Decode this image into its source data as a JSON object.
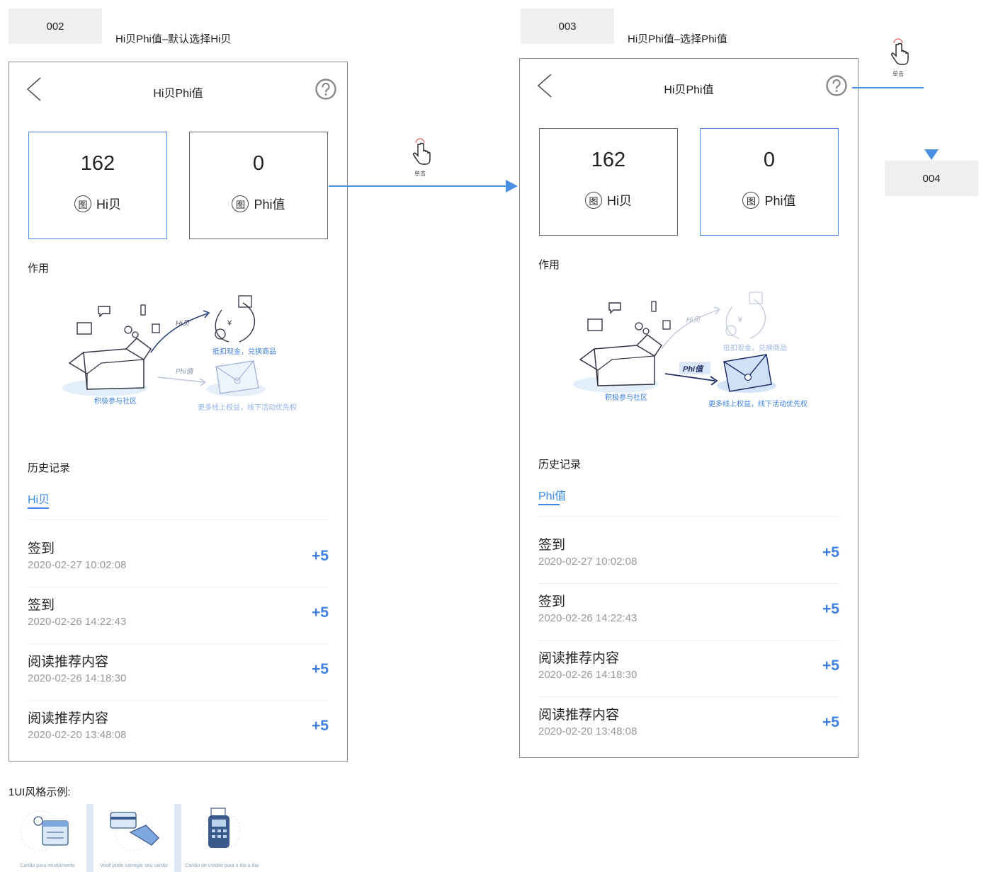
{
  "screens": [
    {
      "id_tag": "002",
      "note": "Hi贝Phi值–默认选择Hi贝",
      "title": "Hi贝Phi值",
      "cards": [
        {
          "value": "162",
          "icon_text": "图",
          "label": "Hi贝",
          "selected": true
        },
        {
          "value": "0",
          "icon_text": "图",
          "label": "Phi值",
          "selected": false
        }
      ],
      "usage_title": "作用",
      "illustration": {
        "hi_label": "Hi贝",
        "phi_label": "Phi值",
        "cash_caption": "抵扣现金，兑换商品",
        "community_caption": "积极参与社区",
        "benefit_caption": "更多线上权益，线下活动优先权"
      },
      "history_title": "历史记录",
      "active_tab": "Hi贝",
      "records": [
        {
          "title": "签到",
          "date": "2020-02-27 10:02:08",
          "amount": "+5"
        },
        {
          "title": "签到",
          "date": "2020-02-26 14:22:43",
          "amount": "+5"
        },
        {
          "title": "阅读推荐内容",
          "date": "2020-02-26 14:18:30",
          "amount": "+5"
        },
        {
          "title": "阅读推荐内容",
          "date": "2020-02-20 13:48:08",
          "amount": "+5"
        }
      ]
    },
    {
      "id_tag": "003",
      "note": "Hi贝Phi值–选择Phi值",
      "title": "Hi贝Phi值",
      "cards": [
        {
          "value": "162",
          "icon_text": "图",
          "label": "Hi贝",
          "selected": false
        },
        {
          "value": "0",
          "icon_text": "图",
          "label": "Phi值",
          "selected": true
        }
      ],
      "usage_title": "作用",
      "illustration": {
        "hi_label": "Hi贝",
        "phi_label": "Phi值",
        "cash_caption": "抵扣现金，兑换商品",
        "community_caption": "积极参与社区",
        "benefit_caption": "更多线上权益，线下活动优先权"
      },
      "history_title": "历史记录",
      "active_tab": "Phi值",
      "records": [
        {
          "title": "签到",
          "date": "2020-02-27 10:02:08",
          "amount": "+5"
        },
        {
          "title": "签到",
          "date": "2020-02-26 14:22:43",
          "amount": "+5"
        },
        {
          "title": "阅读推荐内容",
          "date": "2020-02-26 14:18:30",
          "amount": "+5"
        },
        {
          "title": "阅读推荐内容",
          "date": "2020-02-20 13:48:08",
          "amount": "+5"
        }
      ]
    }
  ],
  "flow": {
    "tap_label": "单击",
    "target_tag": "004",
    "arrow_color": "#4a90e2"
  },
  "style_example": {
    "title": "1UI风格示例:",
    "thumbs": [
      {
        "caption": "Cartão para recebimento"
      },
      {
        "caption": "Você pode carregar seu cartão"
      },
      {
        "caption": "Cartão de crédito para o dia a dia"
      }
    ]
  },
  "colors": {
    "accent": "#3d8be6",
    "amount": "#3d7fe0",
    "date": "#999999",
    "tag_bg": "#efefef"
  }
}
